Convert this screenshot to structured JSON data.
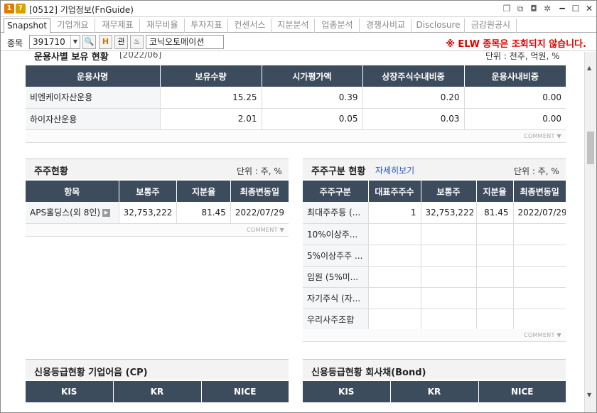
{
  "window": {
    "num1": "1",
    "num2": "?",
    "title": "[0512] 기업정보(FnGuide)",
    "icons": [
      "window-icon",
      "copy-icon",
      "camera-icon",
      "gear-icon",
      "minimize-icon",
      "maximize-icon",
      "close-icon"
    ]
  },
  "tabs": [
    "Snapshot",
    "기업개요",
    "재무제표",
    "재무비율",
    "투자지표",
    "컨센서스",
    "지분분석",
    "업종분석",
    "경쟁사비교",
    "Disclosure",
    "금감원공시"
  ],
  "toolbar": {
    "label": "종목",
    "code": "391710",
    "h_label": "H",
    "gwan_label": "관",
    "company": "코닉오토메이션",
    "notice": "※ ELW 종목은 조회되지 않습니다."
  },
  "fund": {
    "title": "운용사별 보유 현황",
    "date": "[2022/06]",
    "unit": "단위 : 천주, 억원, %",
    "headers": [
      "운용사명",
      "보유수량",
      "시가평가액",
      "상장주식수내비중",
      "운용사내비중"
    ],
    "rows": [
      [
        "비엔케이자산운용",
        "15.25",
        "0.39",
        "0.20",
        "0.00"
      ],
      [
        "하이자산운용",
        "2.01",
        "0.05",
        "0.03",
        "0.00"
      ]
    ]
  },
  "comment": "COMMENT",
  "holders": {
    "title": "주주현황",
    "unit": "단위 : 주, %",
    "headers": [
      "항목",
      "보통주",
      "지분율",
      "최종변동일"
    ],
    "rows": [
      [
        "APS홀딩스(외 8인)",
        "32,753,222",
        "81.45",
        "2022/07/29"
      ]
    ]
  },
  "holder_class": {
    "title": "주주구분 현황",
    "link": "자세히보기",
    "unit": "단위 : 주, %",
    "headers": [
      "주주구분",
      "대표주주수",
      "보통주",
      "지분율",
      "최종변동일"
    ],
    "rows": [
      [
        "최대주주등 (...",
        "1",
        "32,753,222",
        "81.45",
        "2022/07/29"
      ],
      [
        "10%이상주...",
        "",
        "",
        "",
        ""
      ],
      [
        "5%이상주주 ...",
        "",
        "",
        "",
        ""
      ],
      [
        "임원 (5%미...",
        "",
        "",
        "",
        ""
      ],
      [
        "자기주식 (자...",
        "",
        "",
        "",
        ""
      ],
      [
        "우리사주조합",
        "",
        "",
        "",
        ""
      ]
    ]
  },
  "credit_cp": {
    "title": "신용등급현황 기업어음 (CP)",
    "headers": [
      "KIS",
      "KR",
      "NICE"
    ]
  },
  "credit_bond": {
    "title": "신용등급현황 회사채(Bond)",
    "headers": [
      "KIS",
      "KR",
      "NICE"
    ]
  }
}
